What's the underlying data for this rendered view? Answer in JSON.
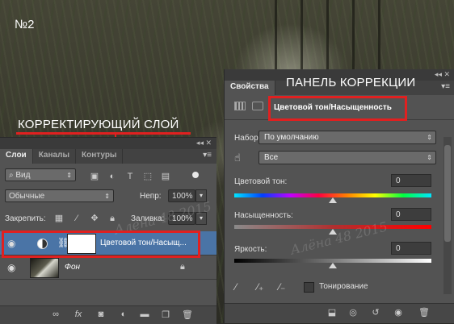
{
  "annotations": {
    "number": "№2",
    "adjustment_layer_label": "КОРРЕКТИРУЮЩИЙ СЛОЙ",
    "correction_panel_label": "ПАНЕЛЬ КОРРЕКЦИИ",
    "watermark": "Алёна 48 2015",
    "highlight_color": "#e02020"
  },
  "layers_panel": {
    "tabs": [
      "Слои",
      "Каналы",
      "Контуры"
    ],
    "active_tab": "Слои",
    "filter": {
      "label": "Вид"
    },
    "filter_icons": [
      "image-filter-icon",
      "adjustment-filter-icon",
      "type-filter-icon",
      "shape-filter-icon",
      "smart-object-filter-icon"
    ],
    "blend_mode": "Обычные",
    "opacity_label": "Непр:",
    "opacity_value": "100%",
    "lock_label": "Закрепить:",
    "fill_label": "Заливка:",
    "fill_value": "100%",
    "layers": [
      {
        "name": "Цветовой тон/Насыщ...",
        "selected": true,
        "type": "adjustment"
      },
      {
        "name": "Фон",
        "selected": false,
        "type": "background",
        "locked": true
      }
    ],
    "bottom_icons": [
      "link-icon",
      "fx-icon",
      "mask-icon",
      "adjustment-icon",
      "folder-icon",
      "new-layer-icon",
      "trash-icon"
    ],
    "fx_label": "fx"
  },
  "properties_panel": {
    "tab": "Свойства",
    "title": "Цветовой тон/Насыщенность",
    "preset_label": "Набор:",
    "preset_value": "По умолчанию",
    "channel_value": "Все",
    "sliders": [
      {
        "label": "Цветовой тон:",
        "value": "0",
        "fraction": 0.5
      },
      {
        "label": "Насыщенность:",
        "value": "0",
        "fraction": 0.5
      },
      {
        "label": "Яркость:",
        "value": "0",
        "fraction": 0.5
      }
    ],
    "colorize_label": "Тонирование",
    "colorize_checked": false
  }
}
